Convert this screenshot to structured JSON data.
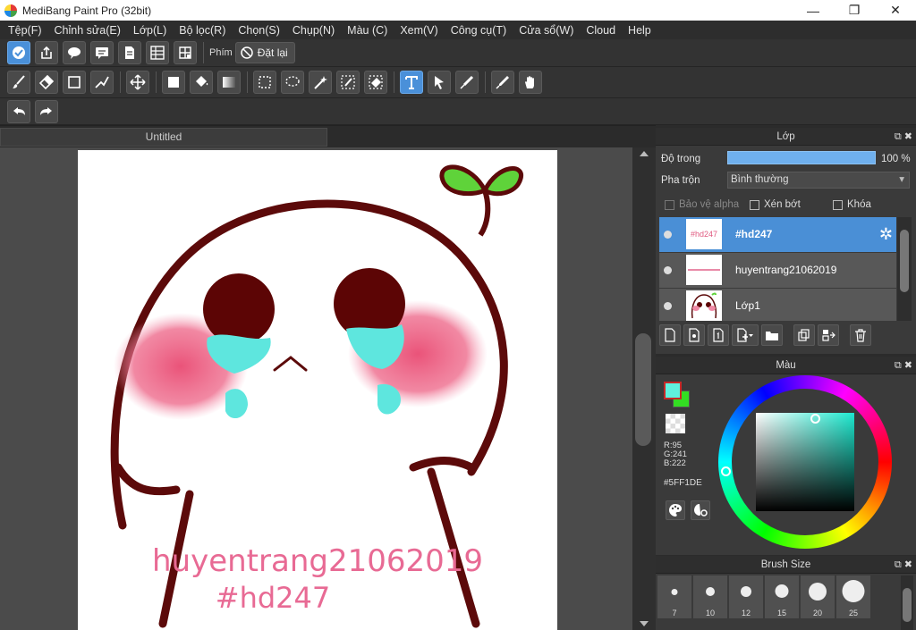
{
  "titlebar": {
    "title": "MediBang Paint Pro (32bit)",
    "min": "—",
    "max": "❐",
    "close": "✕"
  },
  "menu": [
    "Tệp(F)",
    "Chỉnh sửa(E)",
    "Lớp(L)",
    "Bộ lọc(R)",
    "Chọn(S)",
    "Chụp(N)",
    "Màu (C)",
    "Xem(V)",
    "Công cụ(T)",
    "Cửa sổ(W)",
    "Cloud",
    "Help"
  ],
  "toolbar1": {
    "key_label": "Phím",
    "reset_label": "Đặt lại"
  },
  "document": {
    "tab_title": "Untitled"
  },
  "canvas": {
    "watermark1": "huyentrang21062019",
    "watermark2": "#hd247"
  },
  "layer_panel": {
    "title": "Lớp",
    "opacity_label": "Độ trong",
    "opacity_value": "100 %",
    "opacity": 1.0,
    "blend_label": "Pha trộn",
    "blend_value": "Bình thường",
    "protect_alpha": "Bảo vệ alpha",
    "clipping": "Xén bớt",
    "lock": "Khóa",
    "layers": [
      {
        "name": "#hd247",
        "thumb": "#hd247",
        "selected": true
      },
      {
        "name": "huyentrang21062019",
        "thumb": "",
        "selected": false
      },
      {
        "name": "Lớp1",
        "thumb": "",
        "selected": false
      }
    ]
  },
  "color_panel": {
    "title": "Màu",
    "r": "R:95",
    "g": "G:241",
    "b": "B:222",
    "hex": "#5FF1DE",
    "fg_color": "#5ff1de",
    "bg_color": "#33dd22"
  },
  "brush_panel": {
    "title": "Brush Size",
    "sizes": [
      "7",
      "10",
      "12",
      "15",
      "20",
      "25"
    ]
  }
}
